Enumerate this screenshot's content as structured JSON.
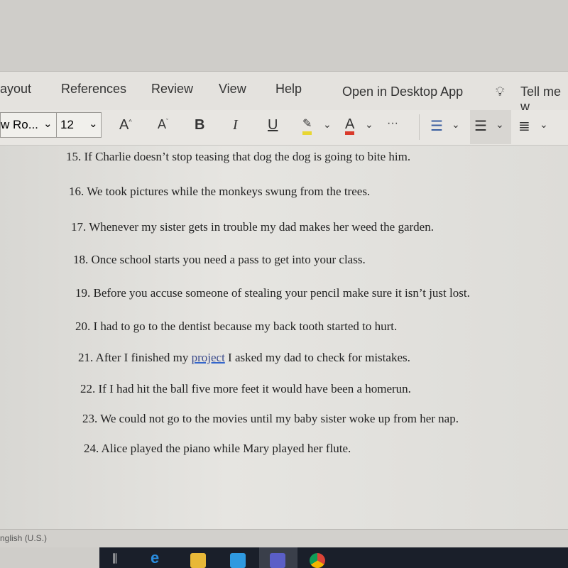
{
  "menubar": {
    "items": [
      "ayout",
      "References",
      "Review",
      "View",
      "Help"
    ],
    "open_desktop": "Open in Desktop App",
    "tell_me": "Tell me w"
  },
  "toolbar": {
    "font_name": "w Ro...",
    "font_size": "12",
    "grow_font": "A",
    "shrink_font": "A",
    "bold": "B",
    "italic": "I",
    "underline": "U",
    "font_color": "A",
    "more": "···",
    "highlight_color": "#e8d632",
    "font_color_bar": "#d93a2b"
  },
  "document": {
    "lines": [
      "15. If Charlie doesn’t stop teasing that dog the dog is going to bite him.",
      "16. We took pictures while the monkeys swung from the trees.",
      "17. Whenever my sister gets in trouble my dad makes her weed the garden.",
      "18. Once school starts you need a pass to get into your class.",
      "19. Before you accuse someone of stealing your pencil make sure it isn’t just lost.",
      "20. I had to go to the dentist because my back tooth started to hurt."
    ],
    "line21": {
      "before": "21. After I finished my ",
      "flagged": "project",
      "after": " I asked my dad to check for mistakes."
    },
    "lines_after": [
      "22. If I had hit the ball five more feet it would have been a homerun.",
      "23. We could not go to the movies until my baby sister woke up from her nap.",
      "24. Alice played the piano while Mary played her flute."
    ]
  },
  "status": {
    "language": "nglish (U.S.)"
  },
  "taskbar": {
    "icons": [
      "task-view-icon",
      "edge-icon",
      "file-explorer-icon",
      "mail-icon",
      "teams-icon",
      "chrome-icon"
    ]
  }
}
